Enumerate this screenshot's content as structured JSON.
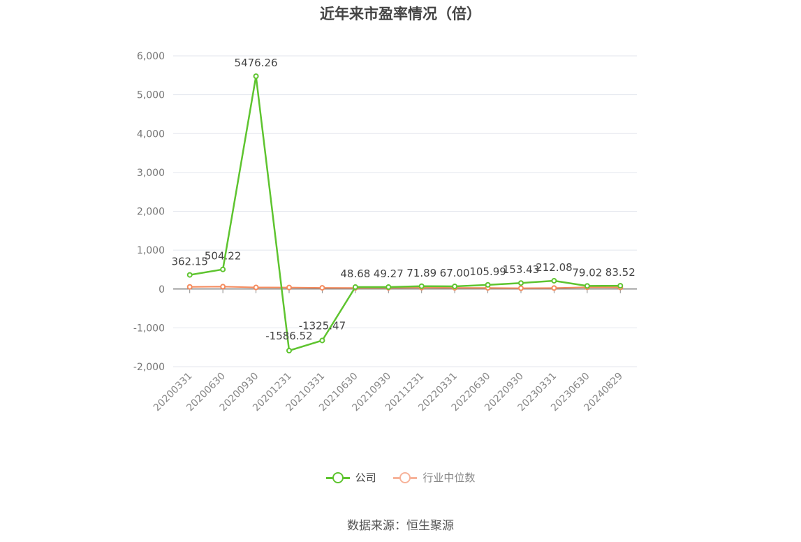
{
  "chart_data": {
    "type": "line",
    "title": "近年来市盈率情况（倍）",
    "categories": [
      "20200331",
      "20200630",
      "20200930",
      "20201231",
      "20210331",
      "20210630",
      "20210930",
      "20211231",
      "20220331",
      "20220630",
      "20220930",
      "20230331",
      "20230630",
      "20240829"
    ],
    "series": [
      {
        "name": "公司",
        "color": "#5ec42f",
        "values": [
          362.15,
          504.22,
          5476.26,
          -1586.52,
          -1325.47,
          48.68,
          49.27,
          71.89,
          67.0,
          105.99,
          153.43,
          212.08,
          79.02,
          83.52
        ],
        "labels": [
          "362.15",
          "504.22",
          "5476.26",
          "-1586.52",
          "-1325.47",
          "48.68",
          "49.27",
          "71.89",
          "67.00",
          "105.99",
          "153.43",
          "212.08",
          "79.02",
          "83.52"
        ]
      },
      {
        "name": "行业中位数",
        "color": "#f58a5c",
        "values": [
          55,
          60,
          40,
          38,
          30,
          28,
          30,
          35,
          30,
          28,
          20,
          25,
          45,
          40
        ]
      }
    ],
    "ylim": [
      -2000,
      6000
    ],
    "yticks": [
      -2000,
      -1000,
      0,
      1000,
      2000,
      3000,
      4000,
      5000,
      6000
    ],
    "ytick_labels": [
      "-2,000",
      "-1,000",
      "0",
      "1,000",
      "2,000",
      "3,000",
      "4,000",
      "5,000",
      "6,000"
    ],
    "grid": true,
    "legend_position": "bottom-center"
  },
  "legend": {
    "company": "公司",
    "industry": "行业中位数"
  },
  "source": "数据来源：恒生聚源"
}
